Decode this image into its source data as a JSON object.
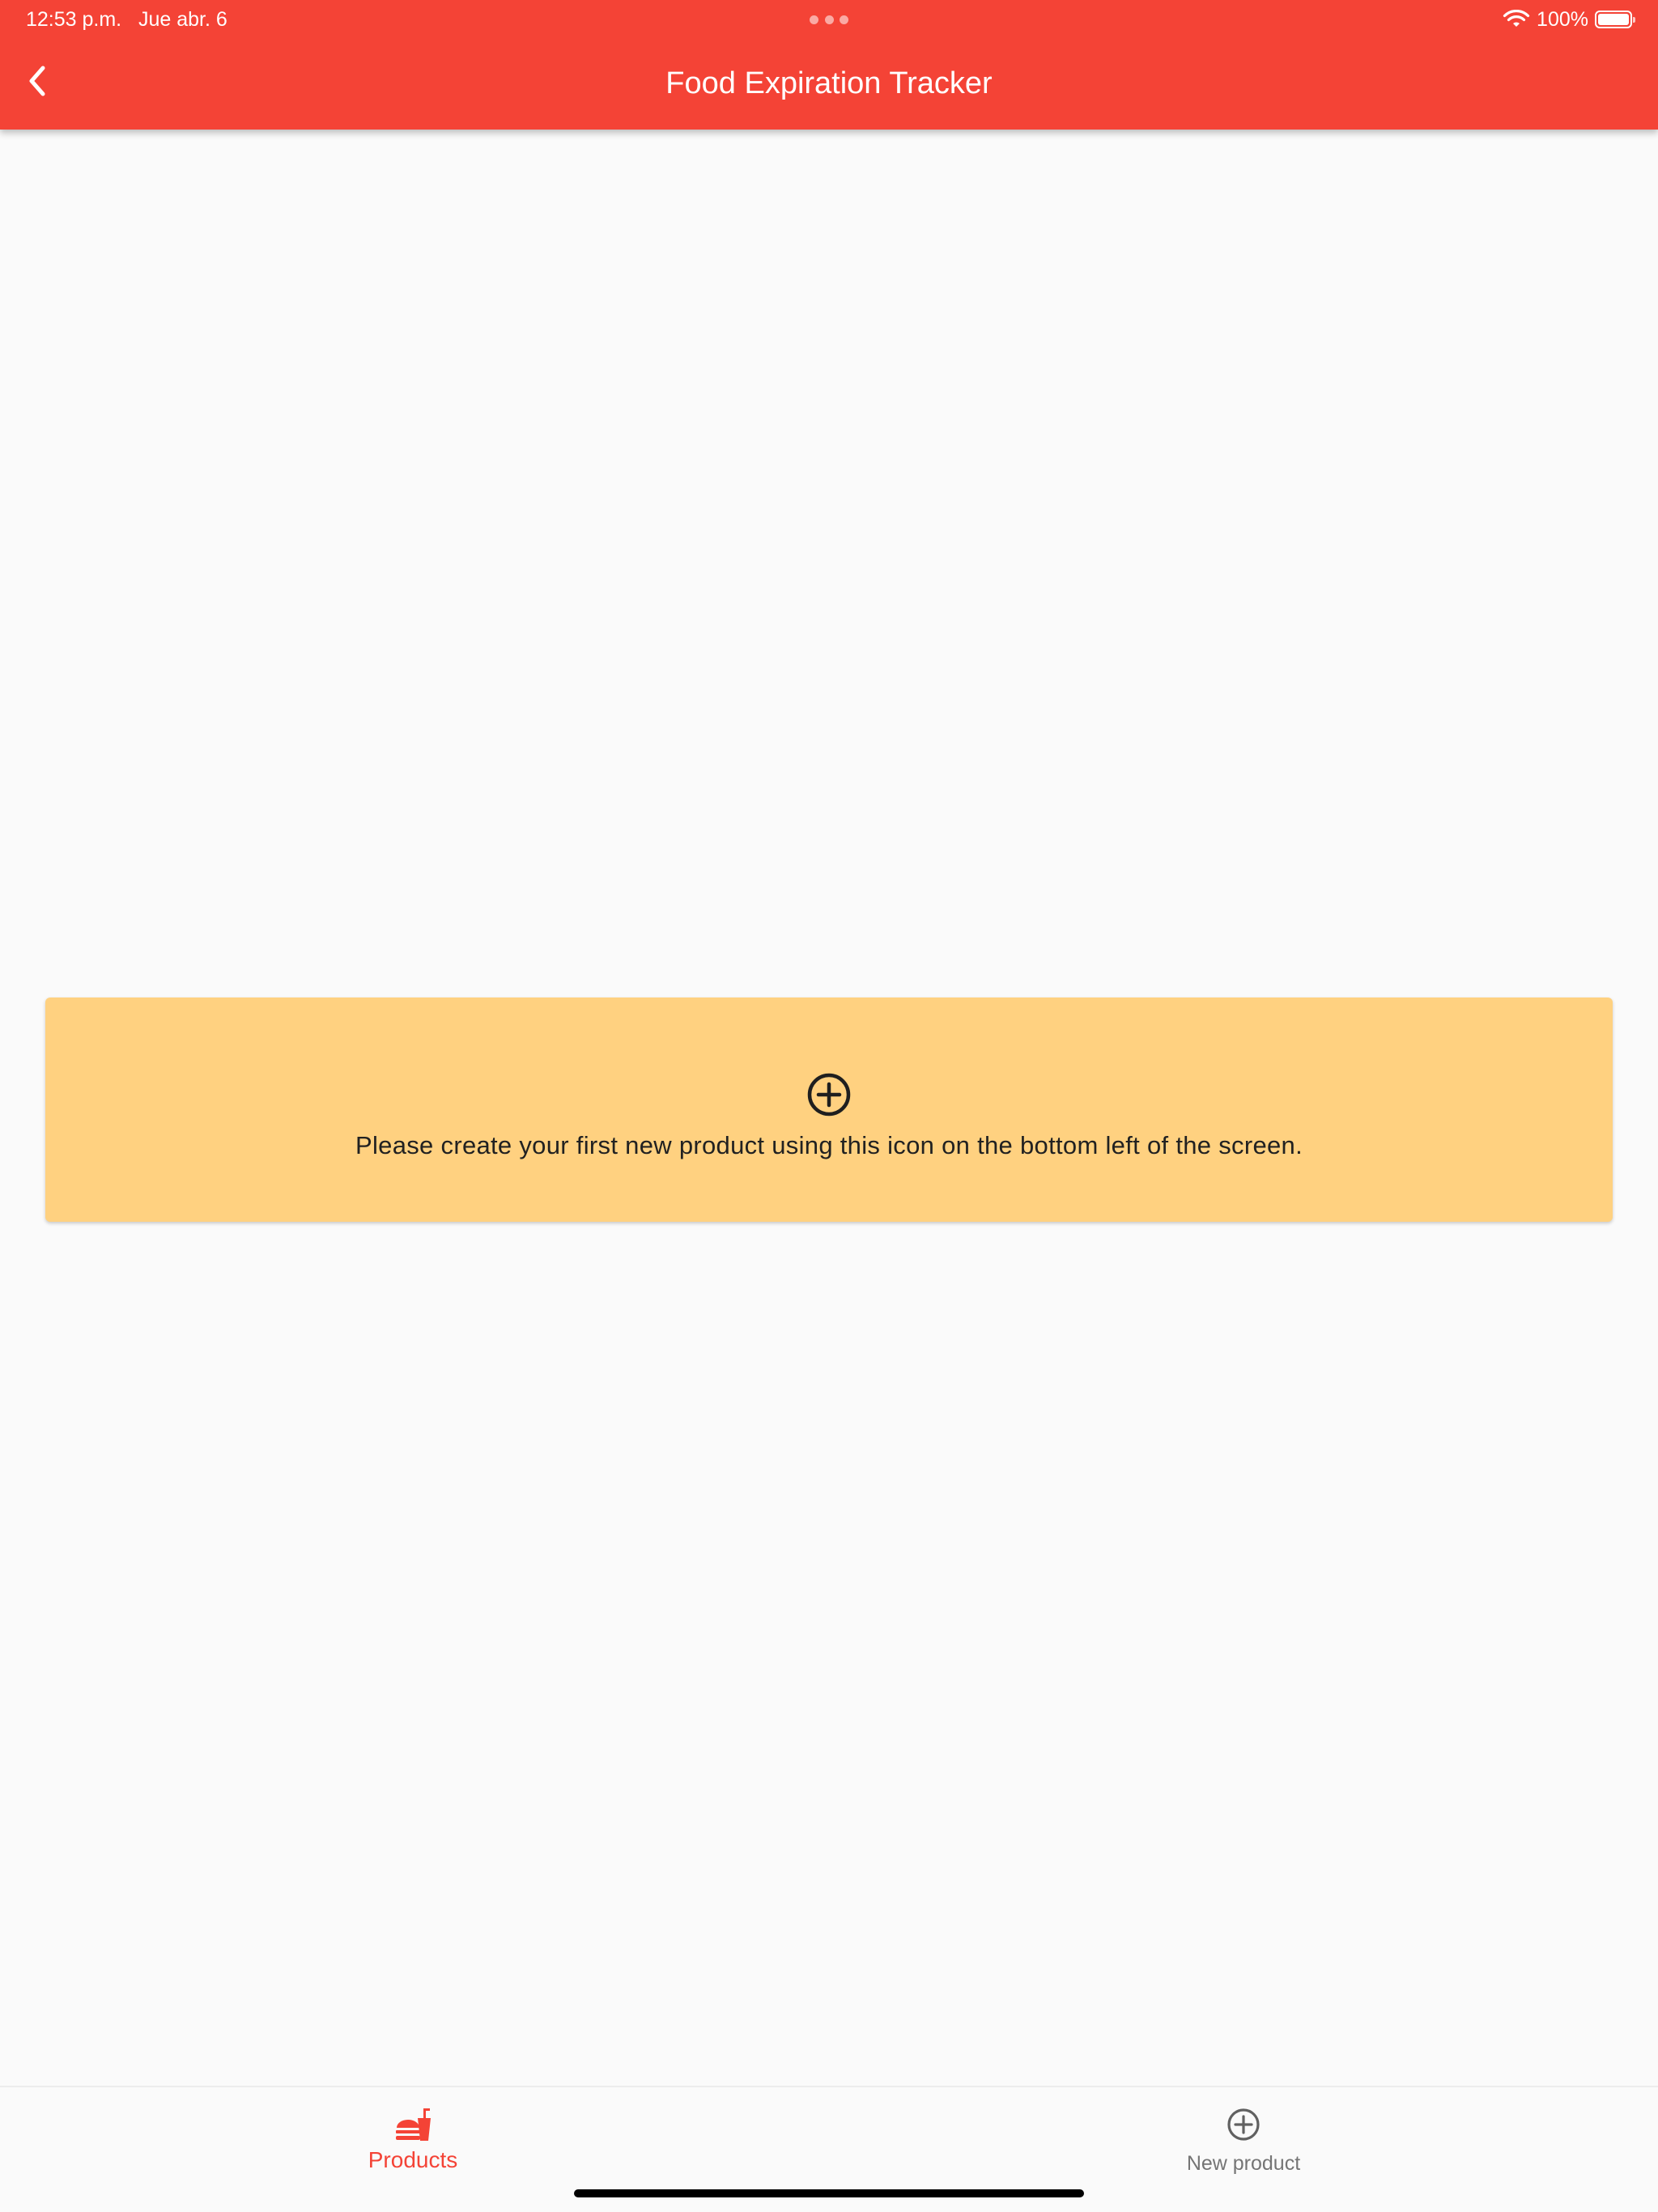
{
  "status_bar": {
    "time_date": "12:53 p.m.   Jue abr. 6",
    "battery": "100%"
  },
  "app_bar": {
    "title": "Food Expiration Tracker",
    "back_icon": "chevron-left-icon",
    "background_color": "#f44336"
  },
  "empty_state": {
    "icon": "add-circle-icon",
    "message": "Please create your first new product using this icon on the bottom left of the screen.",
    "background_color": "#ffd180"
  },
  "bottom_nav": {
    "items": [
      {
        "label": "Products",
        "icon": "fastfood-icon",
        "selected": true,
        "color": "#f44336"
      },
      {
        "label": "New product",
        "icon": "add-circle-icon",
        "selected": false,
        "color": "#757575"
      }
    ]
  }
}
